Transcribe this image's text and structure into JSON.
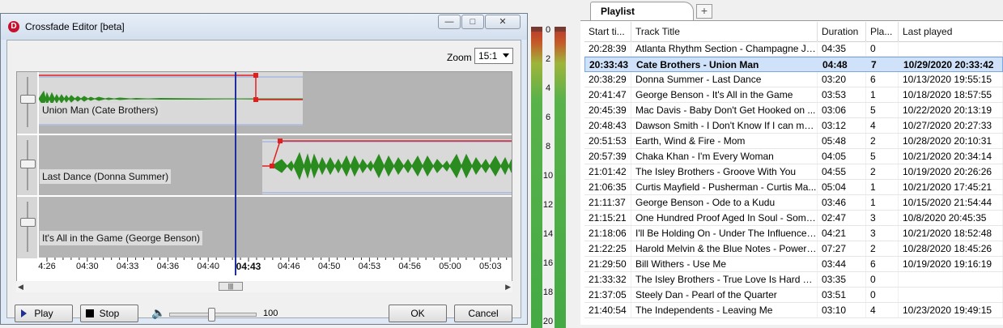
{
  "editor": {
    "title": "Crossfade Editor [beta]",
    "logo_text": "D",
    "zoom_label": "Zoom",
    "zoom_value": "15:1",
    "tracks": [
      {
        "label": "Union Man (Cate Brothers)"
      },
      {
        "label": "Last Dance (Donna Summer)"
      },
      {
        "label": "It's All in the Game (George Benson)"
      }
    ],
    "timeline": [
      "4:26",
      "04:30",
      "04:33",
      "04:36",
      "04:40",
      "04:43",
      "04:46",
      "04:50",
      "04:53",
      "04:56",
      "05:00",
      "05:03"
    ],
    "cursor_time": "04:43",
    "play_label": "Play",
    "stop_label": "Stop",
    "volume_value": "100",
    "volume_level": 0.5,
    "ok_label": "OK",
    "cancel_label": "Cancel"
  },
  "vu": {
    "scale": [
      "0",
      "2",
      "4",
      "6",
      "8",
      "10",
      "12",
      "14",
      "16",
      "18",
      "20"
    ]
  },
  "playlist": {
    "tab_label": "Playlist",
    "columns": [
      "Start ti...",
      "Track Title",
      "Duration",
      "Pla...",
      "Last played"
    ],
    "rows": [
      {
        "start": "20:28:39",
        "title": "Atlanta Rhythm Section - Champagne Ja...",
        "duration": "04:35",
        "plays": "0",
        "last": ""
      },
      {
        "start": "20:33:43",
        "title": "Cate Brothers - Union Man",
        "duration": "04:48",
        "plays": "7",
        "last": "10/29/2020 20:33:42",
        "selected": true
      },
      {
        "start": "20:38:29",
        "title": "Donna Summer - Last Dance",
        "duration": "03:20",
        "plays": "6",
        "last": "10/13/2020 19:55:15"
      },
      {
        "start": "20:41:47",
        "title": "George Benson - It's All in the Game",
        "duration": "03:53",
        "plays": "1",
        "last": "10/18/2020 18:57:55"
      },
      {
        "start": "20:45:39",
        "title": "Mac Davis - Baby Don't Get Hooked on ...",
        "duration": "03:06",
        "plays": "5",
        "last": "10/22/2020 20:13:19"
      },
      {
        "start": "20:48:43",
        "title": "Dawson Smith - I Don't Know If I can ma...",
        "duration": "03:12",
        "plays": "4",
        "last": "10/27/2020 20:27:33"
      },
      {
        "start": "20:51:53",
        "title": "Earth, Wind & Fire - Mom",
        "duration": "05:48",
        "plays": "2",
        "last": "10/28/2020 20:10:31"
      },
      {
        "start": "20:57:39",
        "title": "Chaka Khan - I'm Every Woman",
        "duration": "04:05",
        "plays": "5",
        "last": "10/21/2020 20:34:14"
      },
      {
        "start": "21:01:42",
        "title": "The Isley Brothers - Groove With You",
        "duration": "04:55",
        "plays": "2",
        "last": "10/19/2020 20:26:26"
      },
      {
        "start": "21:06:35",
        "title": "Curtis Mayfield - Pusherman - Curtis Ma...",
        "duration": "05:04",
        "plays": "1",
        "last": "10/21/2020 17:45:21"
      },
      {
        "start": "21:11:37",
        "title": "George Benson - Ode to a Kudu",
        "duration": "03:46",
        "plays": "1",
        "last": "10/15/2020 21:54:44"
      },
      {
        "start": "21:15:21",
        "title": "One Hundred Proof Aged In Soul - Some...",
        "duration": "02:47",
        "plays": "3",
        "last": "10/8/2020 20:45:35"
      },
      {
        "start": "21:18:06",
        "title": "I'll Be Holding On - Under The Influence ...",
        "duration": "04:21",
        "plays": "3",
        "last": "10/21/2020 18:52:48"
      },
      {
        "start": "21:22:25",
        "title": "Harold Melvin & the Blue Notes - Power ...",
        "duration": "07:27",
        "plays": "2",
        "last": "10/28/2020 18:45:26"
      },
      {
        "start": "21:29:50",
        "title": "Bill Withers - Use Me",
        "duration": "03:44",
        "plays": "6",
        "last": "10/19/2020 19:16:19"
      },
      {
        "start": "21:33:32",
        "title": "The Isley Brothers - True Love Is Hard To...",
        "duration": "03:35",
        "plays": "0",
        "last": ""
      },
      {
        "start": "21:37:05",
        "title": "Steely Dan - Pearl of the Quarter",
        "duration": "03:51",
        "plays": "0",
        "last": ""
      },
      {
        "start": "21:40:54",
        "title": "The Independents - Leaving Me",
        "duration": "03:10",
        "plays": "4",
        "last": "10/23/2020 19:49:15"
      }
    ]
  }
}
